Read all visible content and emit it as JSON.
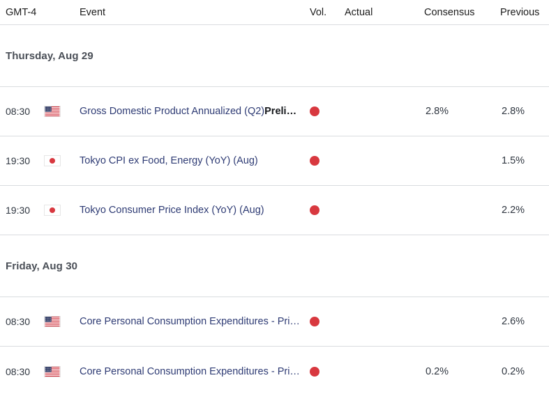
{
  "table": {
    "columns": {
      "time": "GMT-4",
      "event": "Event",
      "volatility": "Vol.",
      "actual": "Actual",
      "consensus": "Consensus",
      "previous": "Previous"
    },
    "groups": [
      {
        "date_label": "Thursday, Aug 29",
        "rows": [
          {
            "time": "08:30",
            "flag": "us-flag-icon",
            "event": "Gross Domestic Product Annualized (Q2)",
            "event_suffix": "Preli…",
            "volatility": "high-volatility-dot",
            "actual": "",
            "consensus": "2.8%",
            "previous": "2.8%"
          },
          {
            "time": "19:30",
            "flag": "jp-flag-icon",
            "event": "Tokyo CPI ex Food, Energy (YoY) (Aug)",
            "event_suffix": "",
            "volatility": "high-volatility-dot",
            "actual": "",
            "consensus": "",
            "previous": "1.5%"
          },
          {
            "time": "19:30",
            "flag": "jp-flag-icon",
            "event": "Tokyo Consumer Price Index (YoY) (Aug)",
            "event_suffix": "",
            "volatility": "high-volatility-dot",
            "actual": "",
            "consensus": "",
            "previous": "2.2%"
          }
        ]
      },
      {
        "date_label": "Friday, Aug 30",
        "rows": [
          {
            "time": "08:30",
            "flag": "us-flag-icon",
            "event": "Core Personal Consumption Expenditures - Pri…",
            "event_suffix": "",
            "volatility": "high-volatility-dot",
            "actual": "",
            "consensus": "",
            "previous": "2.6%"
          },
          {
            "time": "08:30",
            "flag": "us-flag-icon",
            "event": "Core Personal Consumption Expenditures - Pri…",
            "event_suffix": "",
            "volatility": "high-volatility-dot",
            "actual": "",
            "consensus": "0.2%",
            "previous": "0.2%"
          }
        ]
      }
    ]
  },
  "colors": {
    "volatility_high": "#d8383f",
    "event_link": "#2e3b74",
    "row_border": "#d9dcdf",
    "date_label": "#4a4f57"
  }
}
